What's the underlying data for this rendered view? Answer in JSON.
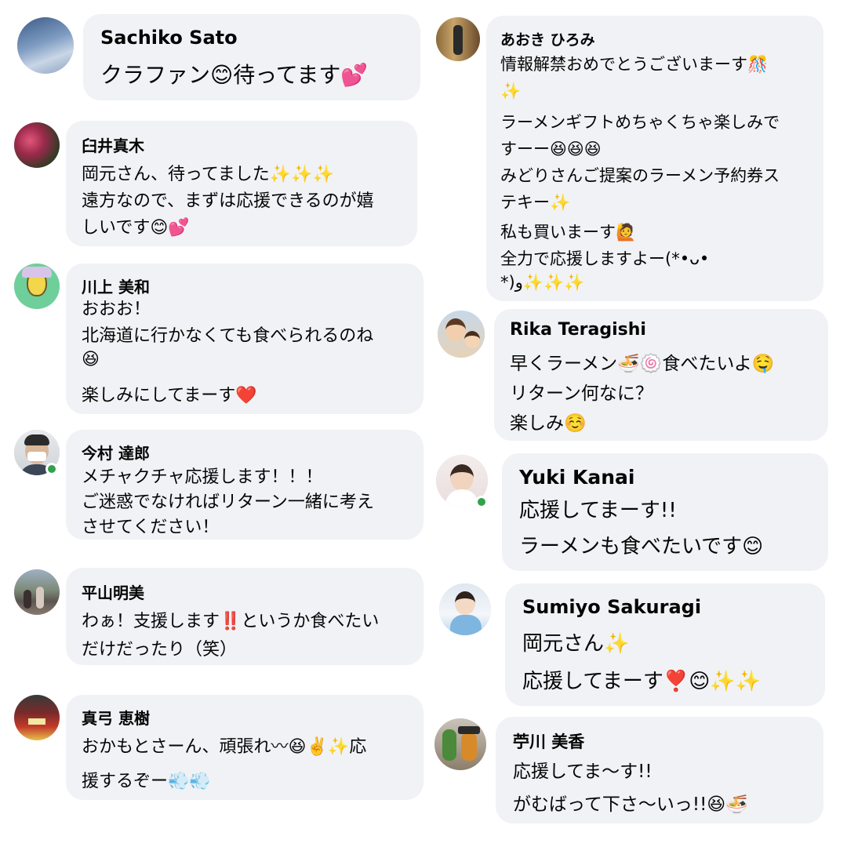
{
  "comments": [
    {
      "name": "Sachiko Sato",
      "lines": [
        "クラファン😊待ってます💕"
      ],
      "avatar": "avatar-sky-photo",
      "online": false
    },
    {
      "name": "臼井真木",
      "lines": [
        "岡元さん、待ってました✨✨✨",
        "遠方なので、まずは応援できるのが嬉",
        "しいです😊💕"
      ],
      "avatar": "avatar-flowers-photo",
      "online": false
    },
    {
      "name": "川上 美和",
      "lines": [
        "おおお！",
        "北海道に行かなくても食べられるのね",
        "😆",
        "楽しみにしてまーす❤️"
      ],
      "avatar": "avatar-illustration",
      "online": false
    },
    {
      "name": "今村 達郎",
      "lines": [
        "メチャクチャ応援します！！！",
        "ご迷惑でなければリターン一緒に考え",
        "させてください！"
      ],
      "avatar": "avatar-man-mask-photo",
      "online": true
    },
    {
      "name": "平山明美",
      "lines": [
        "わぁ！支援します‼️というか食べたい",
        "だけだったり（笑）"
      ],
      "avatar": "avatar-street-photo",
      "online": false
    },
    {
      "name": "真弓 恵樹",
      "lines": [
        "おかもとさーん、頑張れ〰😆✌️✨応",
        "援するぞー💨💨"
      ],
      "avatar": "avatar-festival-photo",
      "online": false
    },
    {
      "name": "あおき ひろみ",
      "lines": [
        "情報解禁おめでとうございまーす🎊",
        "✨",
        "ラーメンギフトめちゃくちゃ楽しみで",
        "すーー😆😆😆",
        "みどりさんご提案のラーメン予約券ス",
        "テキー✨",
        "私も買いまーす🙋",
        "全力で応援しますよー(*•ᴗ•",
        "*)و✨✨✨"
      ],
      "avatar": "avatar-shop-photo",
      "online": false
    },
    {
      "name": "Rika Teragishi",
      "lines": [
        "早くラーメン🍜🍥食べたいよ🤤",
        "リターン何なに？",
        "楽しみ☺️"
      ],
      "avatar": "avatar-family-photo",
      "online": false
    },
    {
      "name": "Yuki Kanai",
      "lines": [
        "応援してまーす!!",
        "ラーメンも食べたいです😊"
      ],
      "avatar": "avatar-woman-photo",
      "online": true
    },
    {
      "name": "Sumiyo Sakuragi",
      "lines": [
        "岡元さん✨",
        "応援してまーす❣️😊✨✨"
      ],
      "avatar": "avatar-smiling-photo",
      "online": false
    },
    {
      "name": "苧川 美香",
      "lines": [
        "応援してま〜す!!",
        "がむばって下さ〜いっ!!😆🍜"
      ],
      "avatar": "avatar-toys-photo",
      "online": false
    }
  ]
}
